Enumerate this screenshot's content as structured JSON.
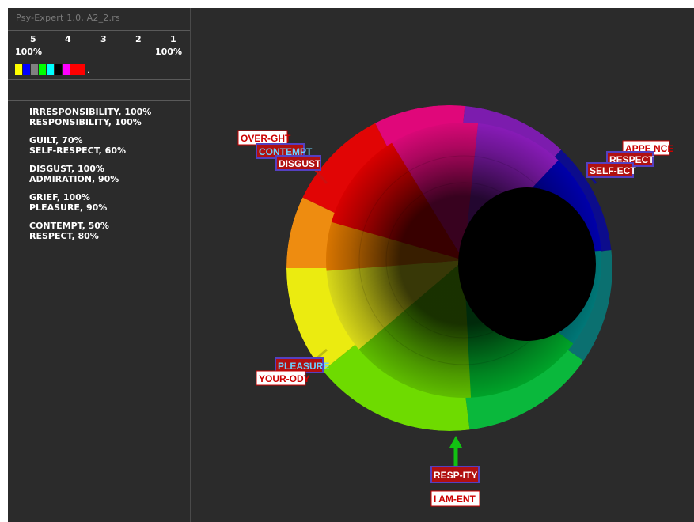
{
  "app": {
    "title": "Psy-Expert 1.0, A2_2.rs"
  },
  "levels": {
    "numbers": [
      "5",
      "4",
      "3",
      "2",
      "1"
    ],
    "left_percent": "100%",
    "right_percent": "100%"
  },
  "swatch_colors": [
    "#ffff00",
    "#0000ff",
    "#808080",
    "#00ff00",
    "#00ffff",
    "#000000",
    "#ff00ff",
    "#ff0000",
    "#ff0000"
  ],
  "swatch_end": ".",
  "pairs": [
    {
      "first": "IRRESPONSIBILITY, 100%",
      "second": "RESPONSIBILITY, 100%"
    },
    {
      "first": "GUILT, 70%",
      "second": "SELF-RESPECT, 60%"
    },
    {
      "first": "DISGUST, 100%",
      "second": "ADMIRATION, 90%"
    },
    {
      "first": "GRIEF, 100%",
      "second": "PLEASURE, 90%"
    },
    {
      "first": "CONTEMPT, 50%",
      "second": "RESPECT, 80%"
    }
  ],
  "wheel_labels": {
    "over": "OVER-GHT",
    "contempt": "CONTEMPT",
    "disgust": "DISGUST",
    "appearance": "APPE NCE",
    "respect": "RESPECT",
    "self_respect": "SELF-ECT",
    "pleasure": "PLEASURE",
    "your_body": "YOUR-ODY",
    "responsibility": "RESP-ITY",
    "i_am": "I AM-ENT"
  }
}
